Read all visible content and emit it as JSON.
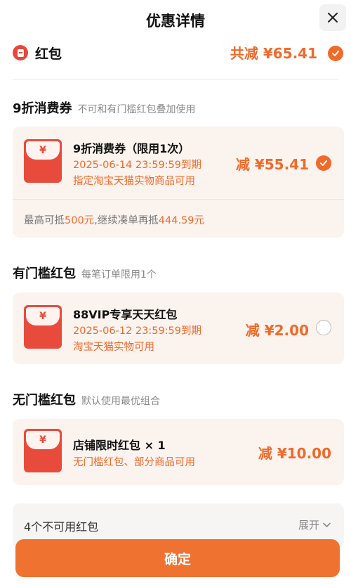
{
  "header": {
    "title": "优惠详情",
    "close_icon": "close-icon"
  },
  "summary": {
    "label": "红包",
    "total": "共减 ¥65.41",
    "checked": true
  },
  "sections": [
    {
      "title": "9折消费券",
      "subtitle": "不可和有门槛红包叠加使用",
      "coupon": {
        "name": "9折消费券（限用1次）",
        "lines": [
          "2025-06-14 23:59:59到期",
          "指定淘宝天猫实物商品可用"
        ],
        "amount": "减 ¥55.41",
        "selected": true,
        "foot_prefix": "最高可抵",
        "foot_value1": "500元",
        "foot_mid": ",继续凑单再抵",
        "foot_value2": "444.59元"
      }
    },
    {
      "title": "有门槛红包",
      "subtitle": "每笔订单限用1个",
      "coupon": {
        "name": "88VIP专享天天红包",
        "lines": [
          "2025-06-12 23:59:59到期",
          "淘宝天猫实物可用"
        ],
        "amount": "减 ¥2.00",
        "selected": false
      }
    },
    {
      "title": "无门槛红包",
      "subtitle": "默认使用最优组合",
      "coupon": {
        "name": "店铺限时红包 × 1",
        "lines": [
          "无门槛红包、部分商品可用"
        ],
        "amount": "减 ¥10.00"
      }
    }
  ],
  "envelope_symbol": "¥",
  "unavailable": {
    "label": "4个不可用红包",
    "expand": "展开"
  },
  "confirm": {
    "label": "确定"
  },
  "colors": {
    "accent": "#ef6a2b",
    "envelope": "#e84b3c",
    "card_bg": "#fbf3ee"
  }
}
